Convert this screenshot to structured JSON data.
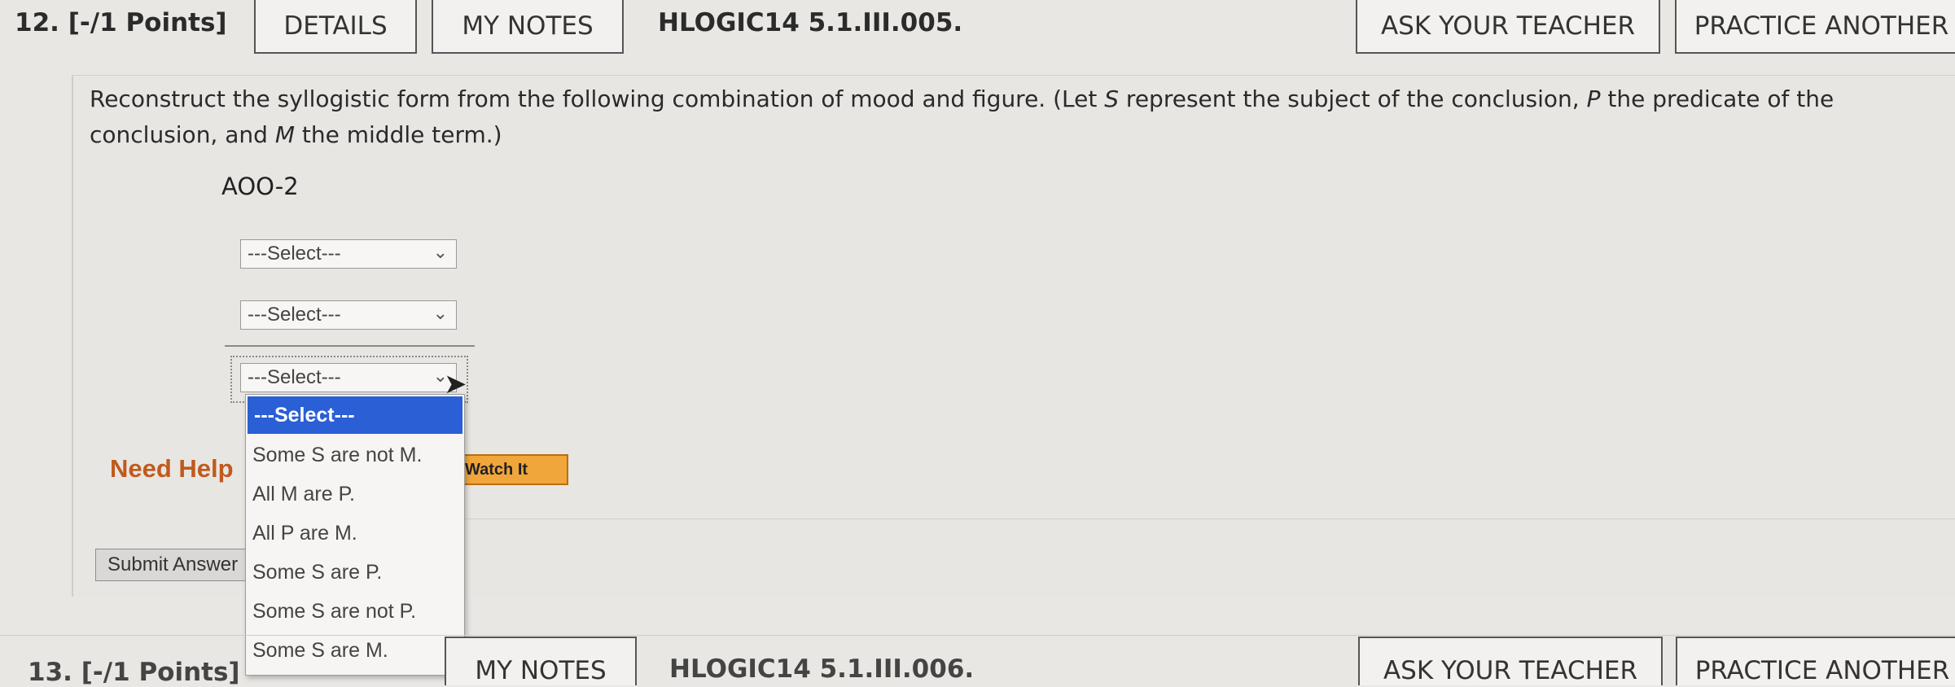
{
  "header": {
    "question_number": "12.",
    "points": "[-/1 Points]",
    "details_label": "DETAILS",
    "my_notes_label": "MY NOTES",
    "code": "HLOGIC14 5.1.III.005.",
    "ask_teacher_label": "ASK YOUR TEACHER",
    "practice_another_label": "PRACTICE ANOTHER"
  },
  "question": {
    "prompt_part1": "Reconstruct the syllogistic form from the following combination of mood and figure. (Let ",
    "S": "S",
    "prompt_part2": " represent the subject of the conclusion, ",
    "P": "P",
    "prompt_part3": " the predicate of the conclusion, and ",
    "M": "M",
    "prompt_part4": " the middle term.)",
    "mood_figure": "AOO-2",
    "select1_value": "---Select---",
    "select2_value": "---Select---",
    "select3_value": "---Select---"
  },
  "dropdown": {
    "options": [
      "---Select---",
      "Some S are not M.",
      "All M are P.",
      "All P are M.",
      "Some S are P.",
      "Some S are not P.",
      "Some S are M."
    ]
  },
  "help": {
    "need_help_label": "Need Help",
    "watch_it_label": "Watch It"
  },
  "submit_label": "Submit Answer",
  "next_question": {
    "question_number": "13.",
    "points": "[-/1 Points]",
    "my_notes_label": "MY NOTES",
    "code": "HLOGIC14 5.1.III.006.",
    "ask_teacher_label": "ASK YOUR TEACHER",
    "practice_another_label": "PRACTICE ANOTHER"
  },
  "colors": {
    "highlight": "#2a5fd6",
    "watch_button": "#f0a63a",
    "need_help": "#c05a1d"
  }
}
